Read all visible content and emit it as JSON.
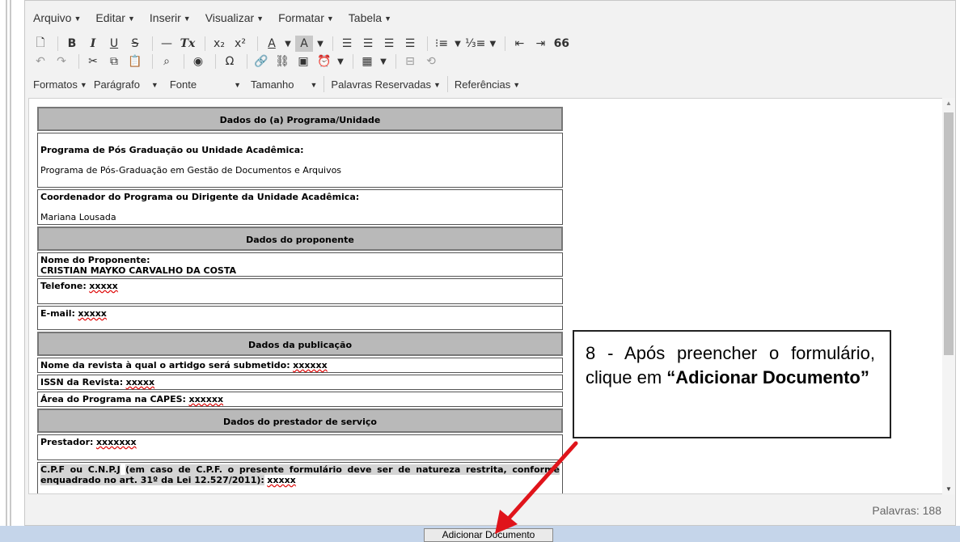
{
  "menu": [
    "Arquivo",
    "Editar",
    "Inserir",
    "Visualizar",
    "Formatar",
    "Tabela"
  ],
  "toolbar_row1": {
    "bold": "B",
    "italic": "I",
    "underline": "U",
    "strike": "S",
    "clear": "Tx",
    "sub": "x₂",
    "sup": "x²",
    "font_color": "A",
    "bg_color": "A",
    "quote": "66"
  },
  "formatbar": {
    "formats": "Formatos",
    "paragraph": "Parágrafo",
    "font": "Fonte",
    "size": "Tamanho",
    "reserved": "Palavras Reservadas",
    "references": "Referências"
  },
  "document": {
    "section1_title": "Dados do (a) Programa/Unidade",
    "program_label": "Programa de Pós Graduação ou Unidade Acadêmica:",
    "program_value": "Programa de Pós-Graduação em Gestão de Documentos e Arquivos",
    "coord_label": "Coordenador do Programa ou Dirigente da Unidade Acadêmica:",
    "coord_value": "Mariana Lousada",
    "section2_title": "Dados do proponente",
    "proponent_label": "Nome do Proponente:",
    "proponent_value": "CRISTIAN MAYKO CARVALHO DA COSTA",
    "phone_label": "Telefone:",
    "phone_value": "xxxxx",
    "email_label": "E-mail:",
    "email_value": "xxxxx",
    "section3_title": "Dados da publicação",
    "journal_label": "Nome da revista à qual o artidgo será submetido:",
    "journal_value": "xxxxxx",
    "issn_label": "ISSN da Revista:",
    "issn_value": "xxxxx",
    "area_label": "Área do Programa na CAPES:",
    "area_value": "xxxxxx",
    "section4_title": "Dados do prestador de serviço",
    "provider_label": "Prestador:",
    "provider_value": "xxxxxxx",
    "cpf_label": "C.P.F ou C.N.P.J",
    "cpf_note": "(em caso de C.P.F. o presente formulário deve ser de natureza restrita, conforme enquadrado no art. 31º da Lei 12.527/2011):",
    "cpf_value": "xxxxx"
  },
  "callout": {
    "text": "8 - Após preencher o formulário, clique em",
    "emphasis": "“Adicionar Documento”"
  },
  "status": {
    "words": "Palavras: 188"
  },
  "button": {
    "add_document": "Adicionar Documento"
  },
  "colors": {
    "arrow": "#e0141b",
    "bottom_bar": "#c5d5ea"
  }
}
